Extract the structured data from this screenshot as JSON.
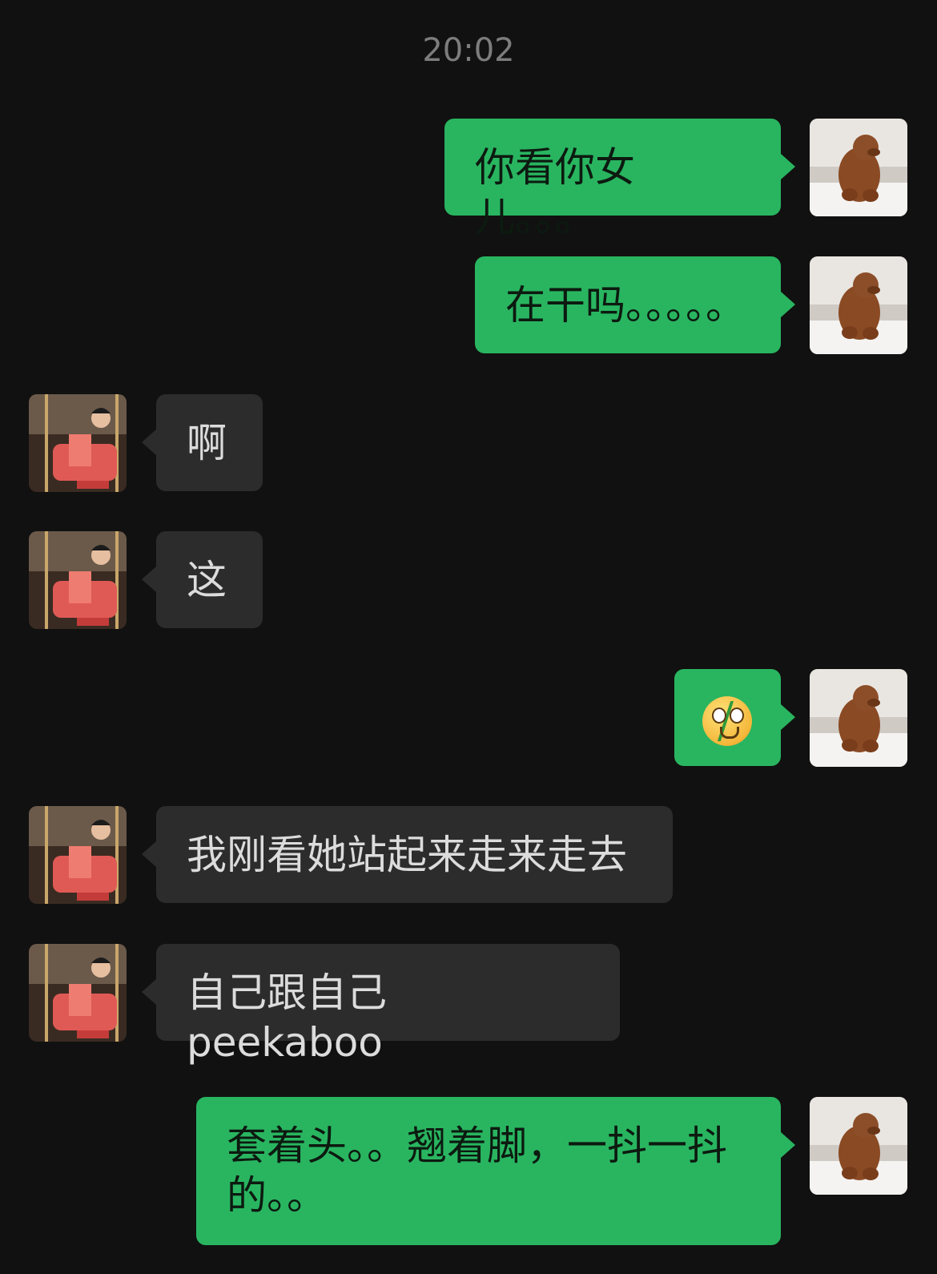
{
  "chat": {
    "timestamp": "20:02",
    "messages": [
      {
        "sender": "me",
        "text": "你看你女儿。。。"
      },
      {
        "sender": "me",
        "text": "在干吗。。。。。"
      },
      {
        "sender": "them",
        "text": "啊"
      },
      {
        "sender": "them",
        "text": "这"
      },
      {
        "sender": "me",
        "emoji": "shaking-face-emoji"
      },
      {
        "sender": "them",
        "text": "我刚看她站起来走来走去"
      },
      {
        "sender": "them",
        "text": "自己跟自己 peekaboo"
      },
      {
        "sender": "me",
        "text": "套着头。。翘着脚，一抖一抖的。。"
      }
    ]
  },
  "avatars": {
    "me": "bear-avatar",
    "them": "woman-avatar"
  },
  "colors": {
    "background": "#111111",
    "my_bubble": "#29b560",
    "their_bubble": "#2c2c2c",
    "timestamp": "#7d7d7d"
  }
}
